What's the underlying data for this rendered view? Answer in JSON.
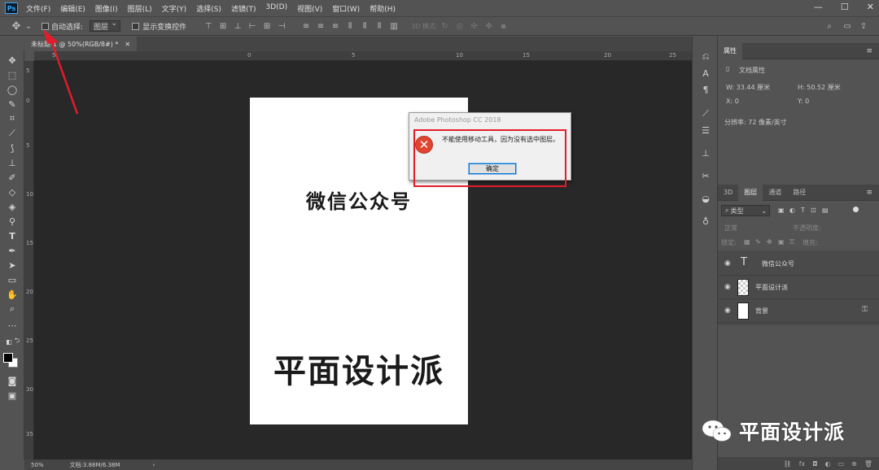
{
  "app": {
    "logo": "Ps"
  },
  "menu": [
    "文件(F)",
    "编辑(E)",
    "图像(I)",
    "图层(L)",
    "文字(Y)",
    "选择(S)",
    "滤镜(T)",
    "3D(D)",
    "视图(V)",
    "窗口(W)",
    "帮助(H)"
  ],
  "window": {
    "minimize": "—",
    "restore": "☐",
    "close": "✕"
  },
  "options": {
    "auto_select_label": "自动选择:",
    "auto_select_value": "图层",
    "show_transform_label": "显示变换控件",
    "mode_3d": "3D 模式:"
  },
  "tab": {
    "title": "未标题-1 @ 50%(RGB/8#) *",
    "close": "✕"
  },
  "ruler": {
    "top": [
      "5",
      "0",
      "5",
      "10",
      "15",
      "20",
      "25"
    ],
    "left": [
      "5",
      "0",
      "5",
      "10",
      "15",
      "20",
      "25",
      "30",
      "35"
    ]
  },
  "document": {
    "line1": "微信公众号",
    "line2": "平面设计派"
  },
  "dialog": {
    "title": "Adobe Photoshop CC 2018",
    "message": "不能使用移动工具，因为没有选中图层。",
    "ok": "确定",
    "icon": "error-icon"
  },
  "status": {
    "zoom": "50%",
    "docsize": "文档:3.88M/6.38M"
  },
  "properties": {
    "tab": "属性",
    "subtitle": "文档属性",
    "w": "W:  33.44 厘米",
    "h": "H:  50.52 厘米",
    "x": "X:  0",
    "y": "Y:  0",
    "resolution": "分辨率: 72 像素/英寸"
  },
  "layers_panel": {
    "tabs": [
      "3D",
      "图层",
      "通道",
      "路径"
    ],
    "filter": "类型",
    "blend": "正常",
    "opacity": "不透明度:",
    "lock": "锁定:",
    "fill": "填充:",
    "layers": [
      {
        "name": "微信公众号",
        "type": "text"
      },
      {
        "name": "平面设计派",
        "type": "smart"
      },
      {
        "name": "背景",
        "type": "background"
      }
    ]
  },
  "watermark": {
    "text": "平面设计派"
  },
  "colors": {
    "accent": "#e41b2a",
    "ps_blue": "#31a8ff",
    "canvas": "#282828"
  }
}
